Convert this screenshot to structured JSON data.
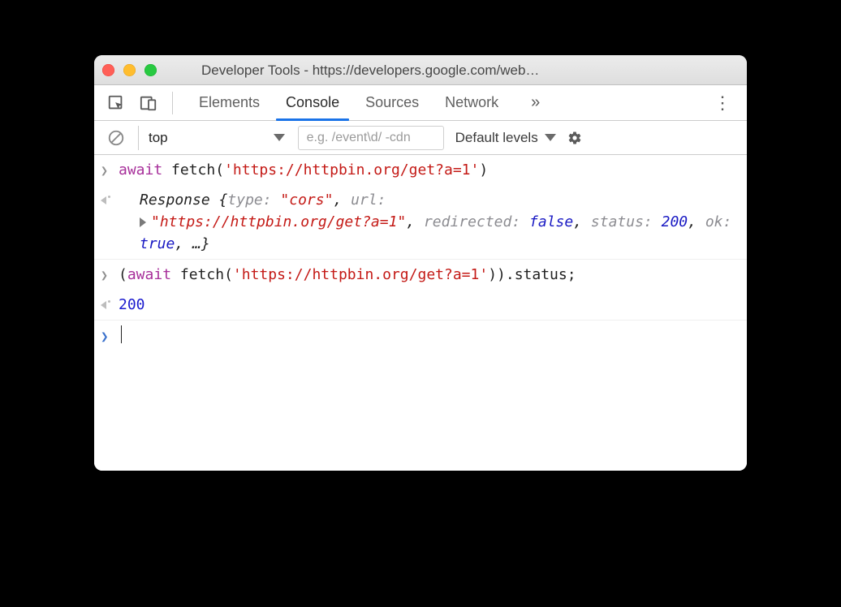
{
  "window": {
    "title": "Developer Tools - https://developers.google.com/web…"
  },
  "tabs": {
    "elements": "Elements",
    "console": "Console",
    "sources": "Sources",
    "network": "Network",
    "overflow": "»"
  },
  "toolbar": {
    "context": "top",
    "filter_placeholder": "e.g. /event\\d/ -cdn",
    "levels": "Default levels"
  },
  "console": {
    "line1": {
      "await": "await",
      "fn": " fetch",
      "paren_open": "(",
      "str": "'https://httpbin.org/get?a=1'",
      "paren_close": ")"
    },
    "response": {
      "obj": "Response ",
      "brace_open": "{",
      "p_type": "type:",
      "v_type": " \"cors\"",
      "c1": ", ",
      "p_url": "url:",
      "v_url": "\"https://httpbin.org/get?a=1\"",
      "c2": ", ",
      "p_redir": "redirected:",
      "v_redir": " false",
      "c3": ", ",
      "p_status": "status:",
      "v_status": " 200",
      "c4": ", ",
      "p_ok": "ok:",
      "v_ok": " true",
      "c5": ", ",
      "ell": "…",
      "brace_close": "}"
    },
    "line2": {
      "paren_open": "(",
      "await": "await",
      "fn": " fetch",
      "paren2_open": "(",
      "str": "'https://httpbin.org/get?a=1'",
      "paren2_close": ")",
      "paren_close": ")",
      "tail": ".status;"
    },
    "result2": "200"
  }
}
